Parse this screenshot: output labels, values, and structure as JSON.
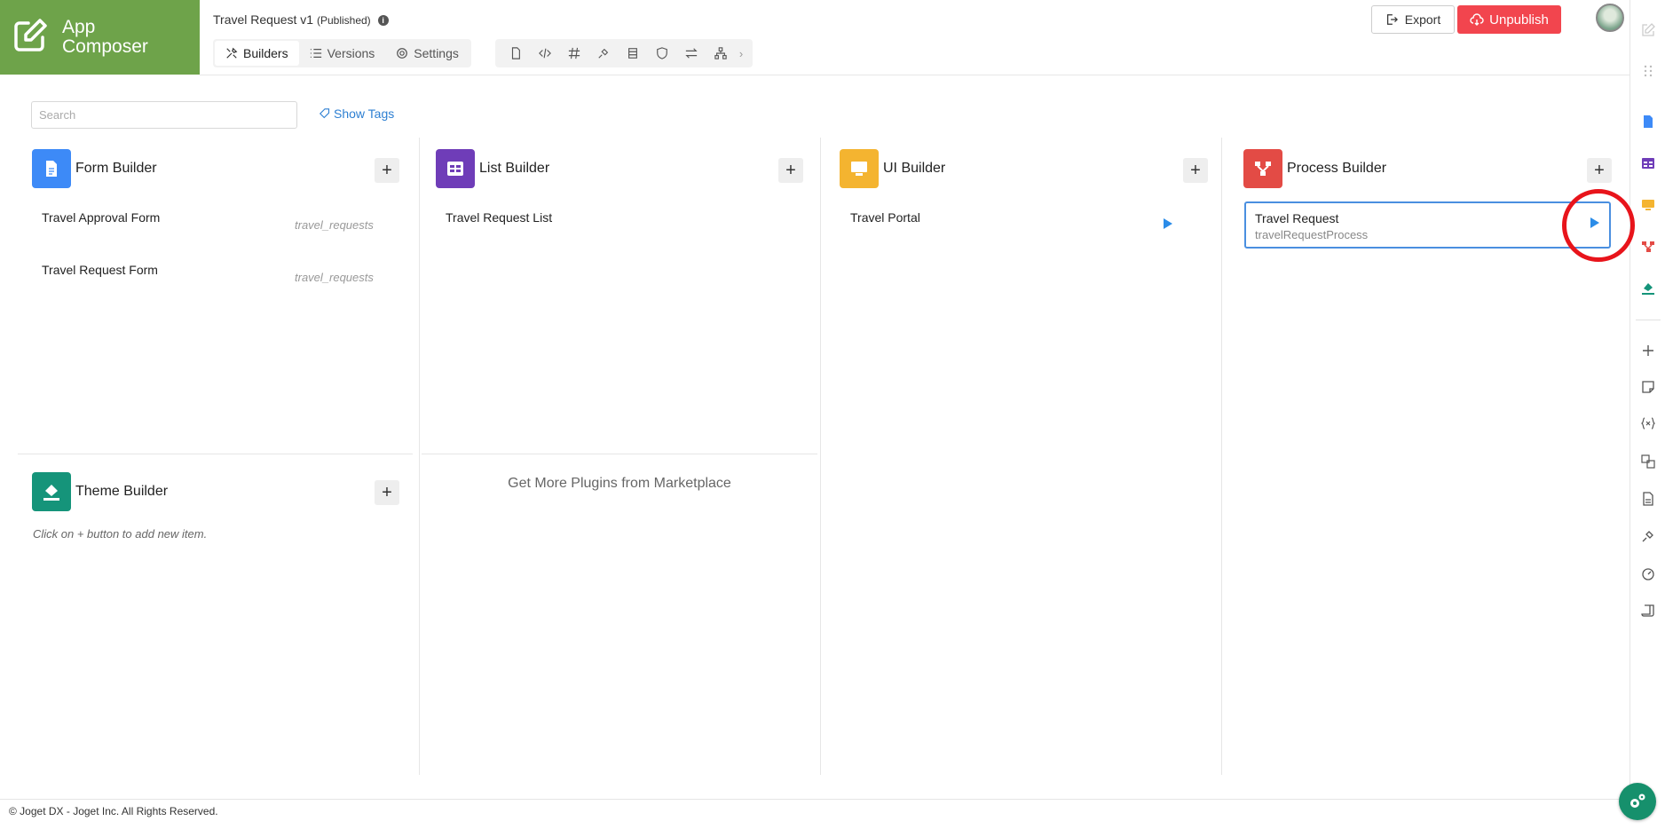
{
  "header": {
    "logo_line1": "App",
    "logo_line2": "Composer",
    "app_title": "Travel Request v1",
    "app_status": "(Published)",
    "info": "i",
    "tabs": [
      {
        "label": "Builders",
        "icon": "tools-icon"
      },
      {
        "label": "Versions",
        "icon": "list-icon"
      },
      {
        "label": "Settings",
        "icon": "gear-icon"
      }
    ],
    "toolbar_more": "›",
    "export_label": "Export",
    "unpublish_label": "Unpublish"
  },
  "search": {
    "placeholder": "Search",
    "show_tags_label": "Show Tags"
  },
  "builders": {
    "form": {
      "title": "Form Builder",
      "color": "#3d8af7",
      "items": [
        {
          "name": "Travel Approval Form",
          "tag": "travel_requests"
        },
        {
          "name": "Travel Request Form",
          "tag": "travel_requests"
        }
      ]
    },
    "list": {
      "title": "List Builder",
      "color": "#6f3db8",
      "items": [
        {
          "name": "Travel Request List"
        }
      ]
    },
    "ui": {
      "title": "UI Builder",
      "color": "#f4b430",
      "items": [
        {
          "name": "Travel Portal"
        }
      ]
    },
    "process": {
      "title": "Process Builder",
      "color": "#e34b45",
      "items": [
        {
          "name": "Travel Request",
          "id": "travelRequestProcess"
        }
      ]
    },
    "theme": {
      "title": "Theme Builder",
      "color": "#15947a",
      "hint": "Click on + button to add new item."
    }
  },
  "add_label": "+",
  "marketplace_label": "Get More Plugins from Marketplace",
  "footer_text": "© Joget DX - Joget Inc. All Rights Reserved.",
  "colors": {
    "logo_bg": "#6ea34a",
    "unpublish": "#f2454e",
    "link": "#2d7fd2",
    "highlight": "#e8141b"
  }
}
